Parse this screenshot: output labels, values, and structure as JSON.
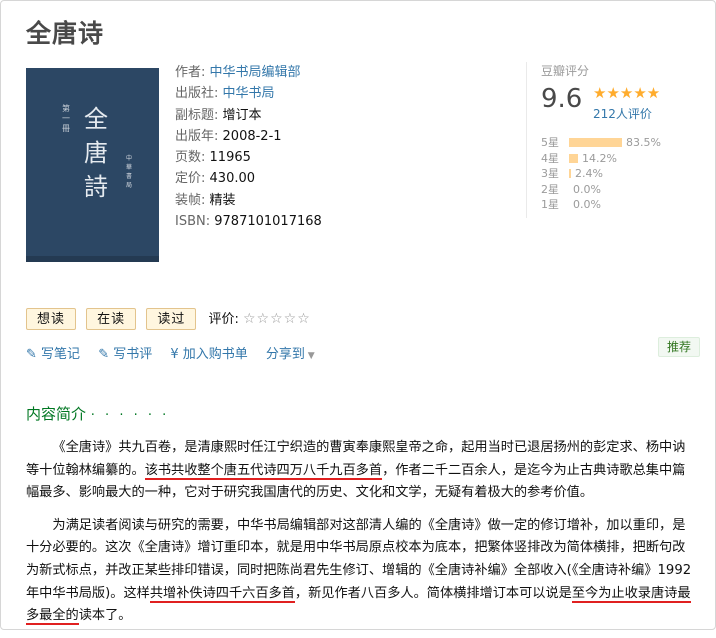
{
  "book": {
    "title": "全唐诗",
    "cover": {
      "volume_text": "第一冊",
      "title_text": "全唐詩",
      "publisher_text": "中華書局"
    },
    "meta": [
      {
        "label": "作者:",
        "value": "中华书局编辑部",
        "link": true
      },
      {
        "label": "出版社:",
        "value": "中华书局",
        "link": true
      },
      {
        "label": "副标题:",
        "value": "增订本",
        "link": false
      },
      {
        "label": "出版年:",
        "value": "2008-2-1",
        "link": false
      },
      {
        "label": "页数:",
        "value": "11965",
        "link": false
      },
      {
        "label": "定价:",
        "value": "430.00",
        "link": false
      },
      {
        "label": "装帧:",
        "value": "精装",
        "link": false
      },
      {
        "label": "ISBN:",
        "value": "9787101017168",
        "link": false
      }
    ]
  },
  "rating": {
    "label": "豆瓣评分",
    "score": "9.6",
    "stars_icon": "five-star-rating",
    "count": "212人评价",
    "distribution": [
      {
        "label": "5星",
        "percent": "83.5%",
        "value": 83.5
      },
      {
        "label": "4星",
        "percent": "14.2%",
        "value": 14.2
      },
      {
        "label": "3星",
        "percent": "2.4%",
        "value": 2.4
      },
      {
        "label": "2星",
        "percent": "0.0%",
        "value": 0.0
      },
      {
        "label": "1星",
        "percent": "0.0%",
        "value": 0.0
      }
    ],
    "bar_color": "#ffd596",
    "star_color": "#ffac2d"
  },
  "actions": {
    "want": "想读",
    "reading": "在读",
    "read": "读过",
    "rate_label": "评价:",
    "rate_stars": "☆☆☆☆☆"
  },
  "tools": {
    "note": "写笔记",
    "review": "写书评",
    "cart": "¥ 加入购书单",
    "share": "分享到",
    "recommend": "推荐"
  },
  "intro": {
    "heading": "内容简介",
    "dots": "· · · · · ·",
    "p1_a": "《全唐诗》共九百卷，是清康熙时任江宁织造的曹寅奉康熙皇帝之命，起用当时已退居扬州的彭定求、杨中讷等十位翰林编纂的。",
    "p1_hl": "该书共收整个唐五代诗四万八千九百多首",
    "p1_b": "，作者二千二百余人，是迄今为止古典诗歌总集中篇幅最多、影响最大的一种，它对于研究我国唐代的历史、文化和文学，无疑有着极大的参考价值。",
    "p2_a": "为满足读者阅读与研究的需要，中华书局编辑部对这部清人编的《全唐诗》做一定的修订增补，加以重印，是十分必要的。这次《全唐诗》增订重印本，就是用中华书局原点校本为底本，把繁体竖排改为简体横排，把断句改为新式标点，并改正某些排印错误，同时把陈尚君先生修订、增辑的《全唐诗补编》全部收入(《全唐诗补编》1992年中华书局版)。这样",
    "p2_hl1": "共增补佚诗四千六百多首",
    "p2_b": "，新见作者八百多人。简体横排增订本可以说是",
    "p2_hl2": "至今为止收录唐诗最多最全的",
    "p2_c": "读本了。"
  }
}
